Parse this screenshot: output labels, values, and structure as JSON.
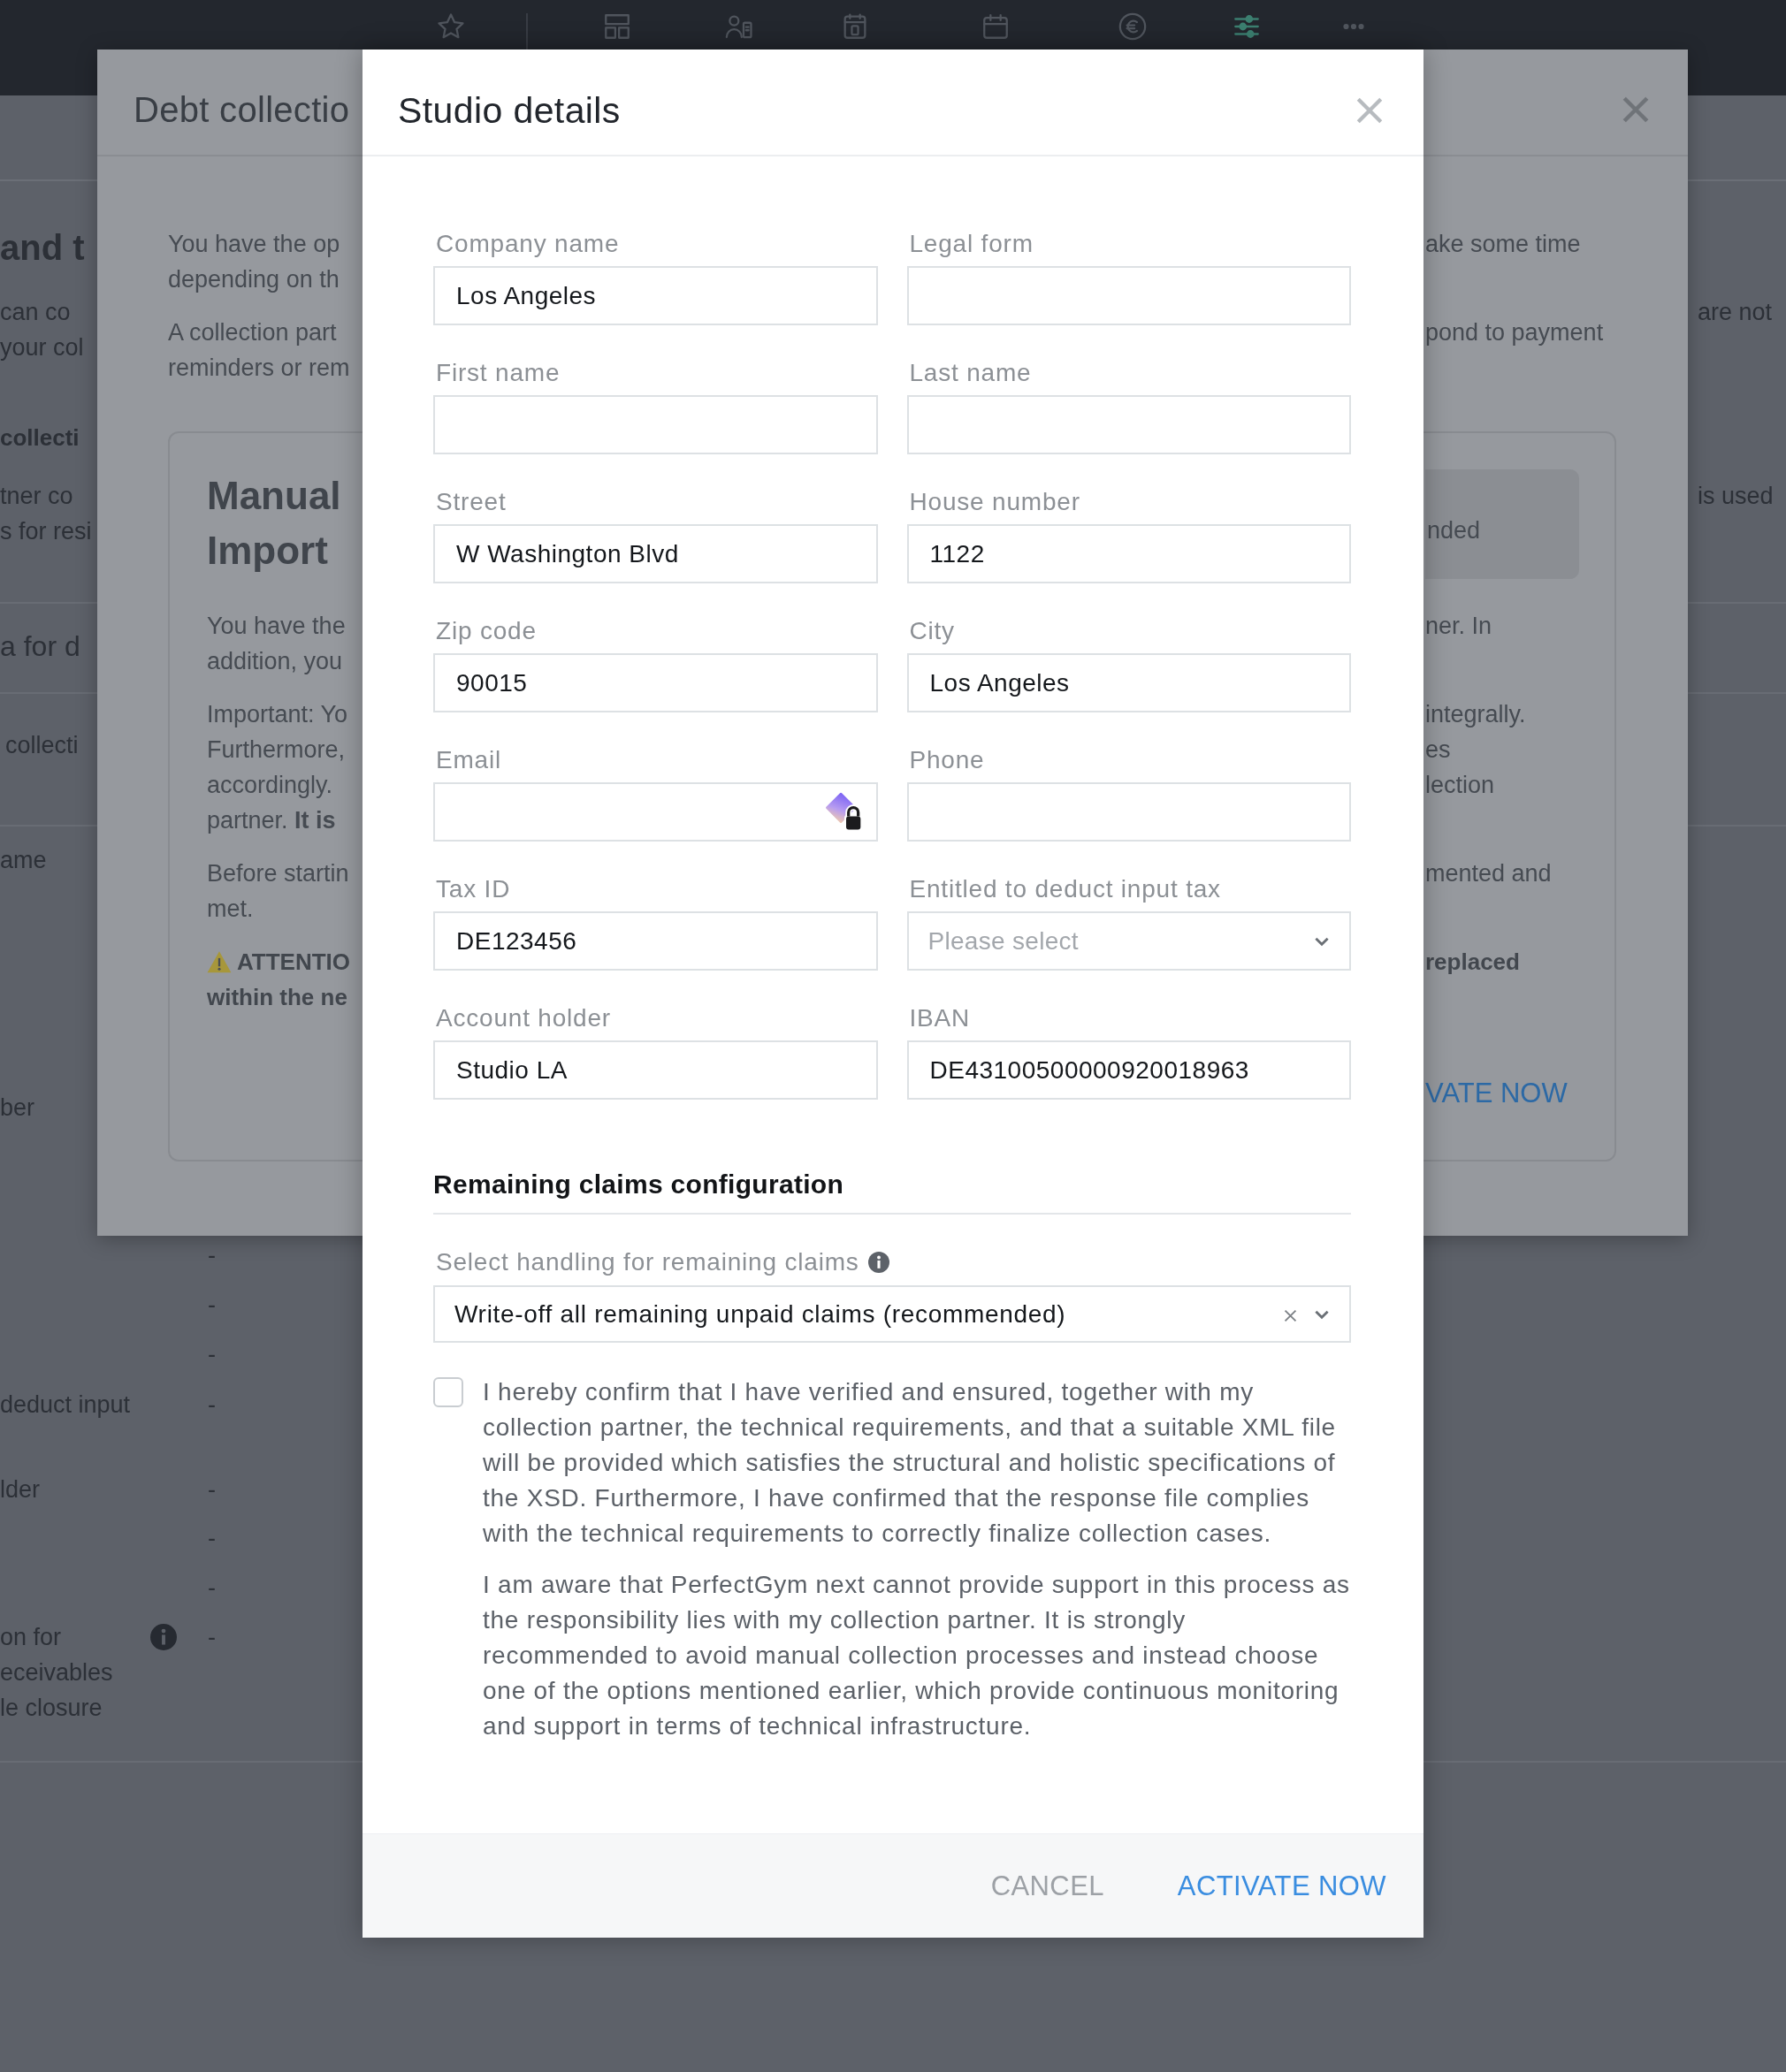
{
  "top_nav": [
    {
      "selected": false
    },
    {
      "selected": false
    },
    {
      "selected": false
    },
    {
      "selected": false
    },
    {
      "selected": false
    },
    {
      "selected": false
    },
    {
      "selected": true
    },
    {
      "selected": false
    }
  ],
  "background_page": {
    "blocks": [
      {
        "kind": "heading",
        "text": "and t"
      },
      {
        "kind": "paragraph",
        "lines": [
          {
            "left": "can co",
            "right": "are not"
          },
          {
            "left": "your col"
          }
        ]
      },
      {
        "kind": "subheading",
        "text": "collecti"
      },
      {
        "kind": "paragraph",
        "lines": [
          {
            "left": "tner co",
            "right": "is used"
          },
          {
            "left": "s for resi"
          }
        ]
      },
      {
        "kind": "divider"
      },
      {
        "kind": "title",
        "text": "a for d"
      },
      {
        "kind": "divider"
      },
      {
        "kind": "label",
        "text": "collecti"
      },
      {
        "kind": "divider"
      }
    ],
    "rows": [
      {
        "label_lines": [
          "ame"
        ],
        "info": false
      },
      {
        "label_lines": [
          "ber"
        ],
        "info": false
      },
      {
        "value": "-",
        "info": false
      },
      {
        "value": "-",
        "info": false
      },
      {
        "value": "-",
        "info": false
      },
      {
        "label_lines": [
          "deduct input"
        ],
        "value": "-",
        "info": false
      },
      {
        "label_lines": [
          "lder"
        ],
        "value": "-",
        "info": false
      },
      {
        "value": "-",
        "info": false
      },
      {
        "value": "-",
        "info": false
      },
      {
        "label_lines": [
          "on for",
          "eceivables",
          "le closure"
        ],
        "value": "-",
        "info": true
      }
    ]
  },
  "debt_collection_dialog": {
    "title": "Debt collectio",
    "paragraphs": [
      {
        "lines": [
          {
            "left": "You have the op",
            "right": "ake some time"
          },
          {
            "left": "depending on th"
          }
        ]
      },
      {
        "lines": [
          {
            "left": "A collection part",
            "right": "pond to payment"
          },
          {
            "left": "reminders or rem"
          }
        ]
      }
    ],
    "card": {
      "heading_lines": [
        "Manual",
        "Import"
      ],
      "badge": "nded",
      "paragraphs": [
        {
          "kind": "text",
          "lines": [
            {
              "left": "You have the",
              "right": "ner. In"
            },
            {
              "left": "addition, you"
            }
          ]
        },
        {
          "kind": "text",
          "lines": [
            {
              "left": "Important: Yo",
              "right": "integrally."
            },
            {
              "left": "Furthermore,",
              "right": "es"
            },
            {
              "left": "accordingly.",
              "right": "lection"
            },
            {
              "left": "partner. **It is**"
            }
          ]
        },
        {
          "kind": "text",
          "lines": [
            {
              "left": "Before startin",
              "right": "mented and"
            },
            {
              "left": "met."
            }
          ]
        },
        {
          "kind": "warning",
          "lines": [
            {
              "left": "ATTENTIO",
              "right": "replaced"
            },
            {
              "left": "within the ne"
            }
          ]
        }
      ],
      "link": "VATE NOW"
    }
  },
  "studio_details_dialog": {
    "title": "Studio details",
    "fields": [
      {
        "label": "Company name",
        "value": "Los Angeles",
        "kind": "text"
      },
      {
        "label": "Legal form",
        "kind": "text"
      },
      {
        "label": "First name",
        "kind": "text"
      },
      {
        "label": "Last name",
        "kind": "text"
      },
      {
        "label": "Street",
        "value": "W Washington Blvd",
        "kind": "text"
      },
      {
        "label": "House number",
        "value": "1122",
        "kind": "text"
      },
      {
        "label": "Zip code",
        "value": "90015",
        "kind": "text"
      },
      {
        "label": "City",
        "value": "Los Angeles",
        "kind": "text"
      },
      {
        "label": "Email",
        "kind": "email"
      },
      {
        "label": "Phone",
        "kind": "text"
      },
      {
        "label": "Tax ID",
        "value": "DE123456",
        "kind": "text"
      },
      {
        "label": "Entitled to deduct input tax",
        "placeholder": "Please select",
        "kind": "select"
      },
      {
        "label": "Account holder",
        "value": "Studio LA",
        "kind": "text"
      },
      {
        "label": "IBAN",
        "value": "DE43100500000920018963",
        "kind": "text"
      }
    ],
    "section_title": "Remaining claims configuration",
    "claims_select": {
      "label": "Select handling for remaining claims",
      "info": true,
      "value": "Write-off all remaining unpaid claims (recommended)",
      "clearable": true
    },
    "confirmation": {
      "checked": false,
      "paragraphs": [
        "I hereby confirm that I have verified and ensured, together with my collection partner, the technical requirements, and that a suitable XML file will be provided which satisfies the structural and holistic specifications of the XSD. Furthermore, I have confirmed that the response file complies with the technical requirements to correctly finalize collection cases.",
        "I am aware that PerfectGym next cannot provide support in this process as the responsibility lies with my collection partner. It is strongly recommended to avoid manual collection processes and instead choose one of the options mentioned earlier, which provide continuous monitoring and support in terms of technical infrastructure."
      ]
    },
    "buttons": [
      {
        "label": "CANCEL",
        "kind": "secondary"
      },
      {
        "label": "ACTIVATE NOW",
        "kind": "primary"
      }
    ]
  }
}
